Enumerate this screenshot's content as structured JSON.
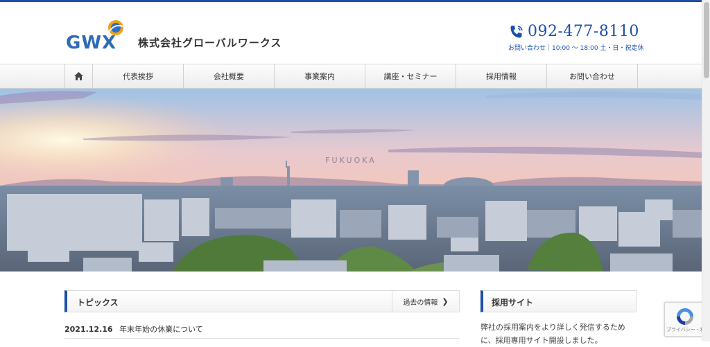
{
  "header": {
    "logo_text": "GWX",
    "company_name": "株式会社グローバルワークス",
    "phone": "092-477-8110",
    "hours": "お問い合わせ｜10:00 ～ 18:00 土・日・祝定休"
  },
  "nav": {
    "items": [
      {
        "label": "代表挨拶"
      },
      {
        "label": "会社概要"
      },
      {
        "label": "事業案内"
      },
      {
        "label": "講座・セミナー"
      },
      {
        "label": "採用情報"
      },
      {
        "label": "お問い合わせ"
      }
    ]
  },
  "hero": {
    "caption": "FUKUOKA"
  },
  "topics": {
    "title": "トピックス",
    "more_label": "過去の情報",
    "news": [
      {
        "date": "2021.12.16",
        "title": "年末年始の休業について"
      }
    ]
  },
  "recruit": {
    "title": "採用サイト",
    "text": "弊社の採用案内をより詳しく発信するために、採用専用サイト開設しました。"
  },
  "recaptcha": {
    "text": "プライバシー・利用規約"
  },
  "colors": {
    "accent": "#1e4fa8"
  }
}
